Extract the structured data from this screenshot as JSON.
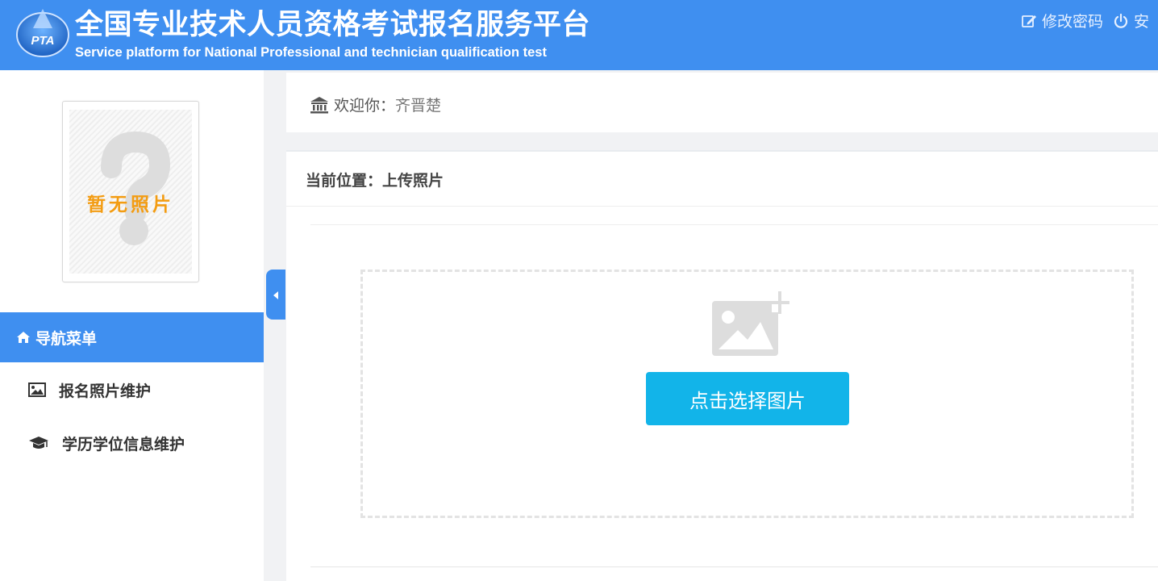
{
  "header": {
    "logo_text": "PTA",
    "title": "全国专业技术人员资格考试报名服务平台",
    "subtitle": "Service platform for National Professional and technician qualification test",
    "actions": [
      {
        "icon": "edit-icon",
        "label": "修改密码"
      },
      {
        "icon": "power-icon",
        "label": "安"
      }
    ]
  },
  "sidebar": {
    "photo_placeholder": "暂无照片",
    "nav_title": "导航菜单",
    "items": [
      {
        "icon": "image-icon",
        "label": "报名照片维护"
      },
      {
        "icon": "graduation-cap-icon",
        "label": "学历学位信息维护"
      }
    ]
  },
  "welcome": {
    "label": "欢迎你：",
    "name": "齐晋楚"
  },
  "main": {
    "breadcrumb": "当前位置：上传照片",
    "upload_button": "点击选择图片"
  },
  "colors": {
    "primary": "#3f8ff0",
    "button": "#12b4e9",
    "placeholder_text": "#f39c12"
  }
}
